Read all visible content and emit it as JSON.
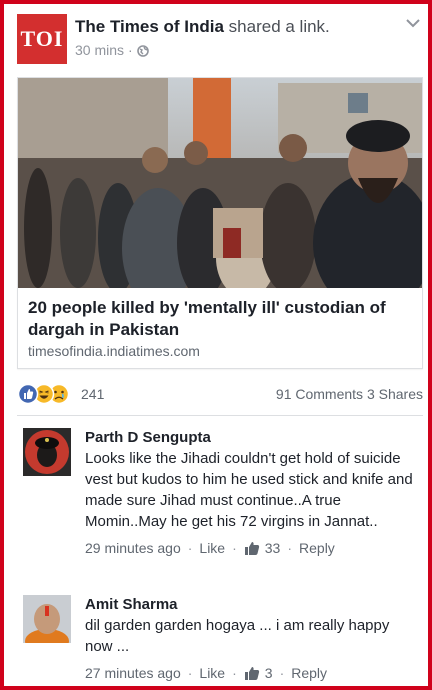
{
  "post": {
    "page_name": "The Times of India",
    "action": "shared a link.",
    "logo_text": "TOI",
    "time": "30 mins",
    "dot": "·"
  },
  "link": {
    "headline": "20 people killed by 'mentally ill' custodian of dargah in Pakistan",
    "domain": "timesofindia.indiatimes.com"
  },
  "reactions": {
    "count": "241",
    "comments": "91 Comments",
    "shares": "3 Shares",
    "types": [
      "like",
      "haha",
      "sad"
    ]
  },
  "comments": [
    {
      "author": "Parth D Sengupta",
      "text": "Looks like the Jihadi couldn't get hold of suicide vest but kudos to him he used stick and knife and made sure Jihad must continue..A true Momin..May he get his 72 virgins in Jannat..",
      "time": "29 minutes ago",
      "like_label": "Like",
      "likes": "33",
      "reply_label": "Reply"
    },
    {
      "author": "Amit Sharma",
      "text": "dil garden garden hogaya ... i am really happy now ...",
      "time": "27 minutes ago",
      "like_label": "Like",
      "likes": "3",
      "reply_label": "Reply"
    }
  ],
  "colors": {
    "frame": "#d0021b",
    "logo": "#d32f2f",
    "like_blue": "#4267b2",
    "reaction_yellow": "#f7b928"
  },
  "icons": [
    "globe-icon",
    "chevron-down-icon",
    "like-reaction-icon",
    "haha-reaction-icon",
    "sad-reaction-icon",
    "thumbs-up-icon"
  ]
}
